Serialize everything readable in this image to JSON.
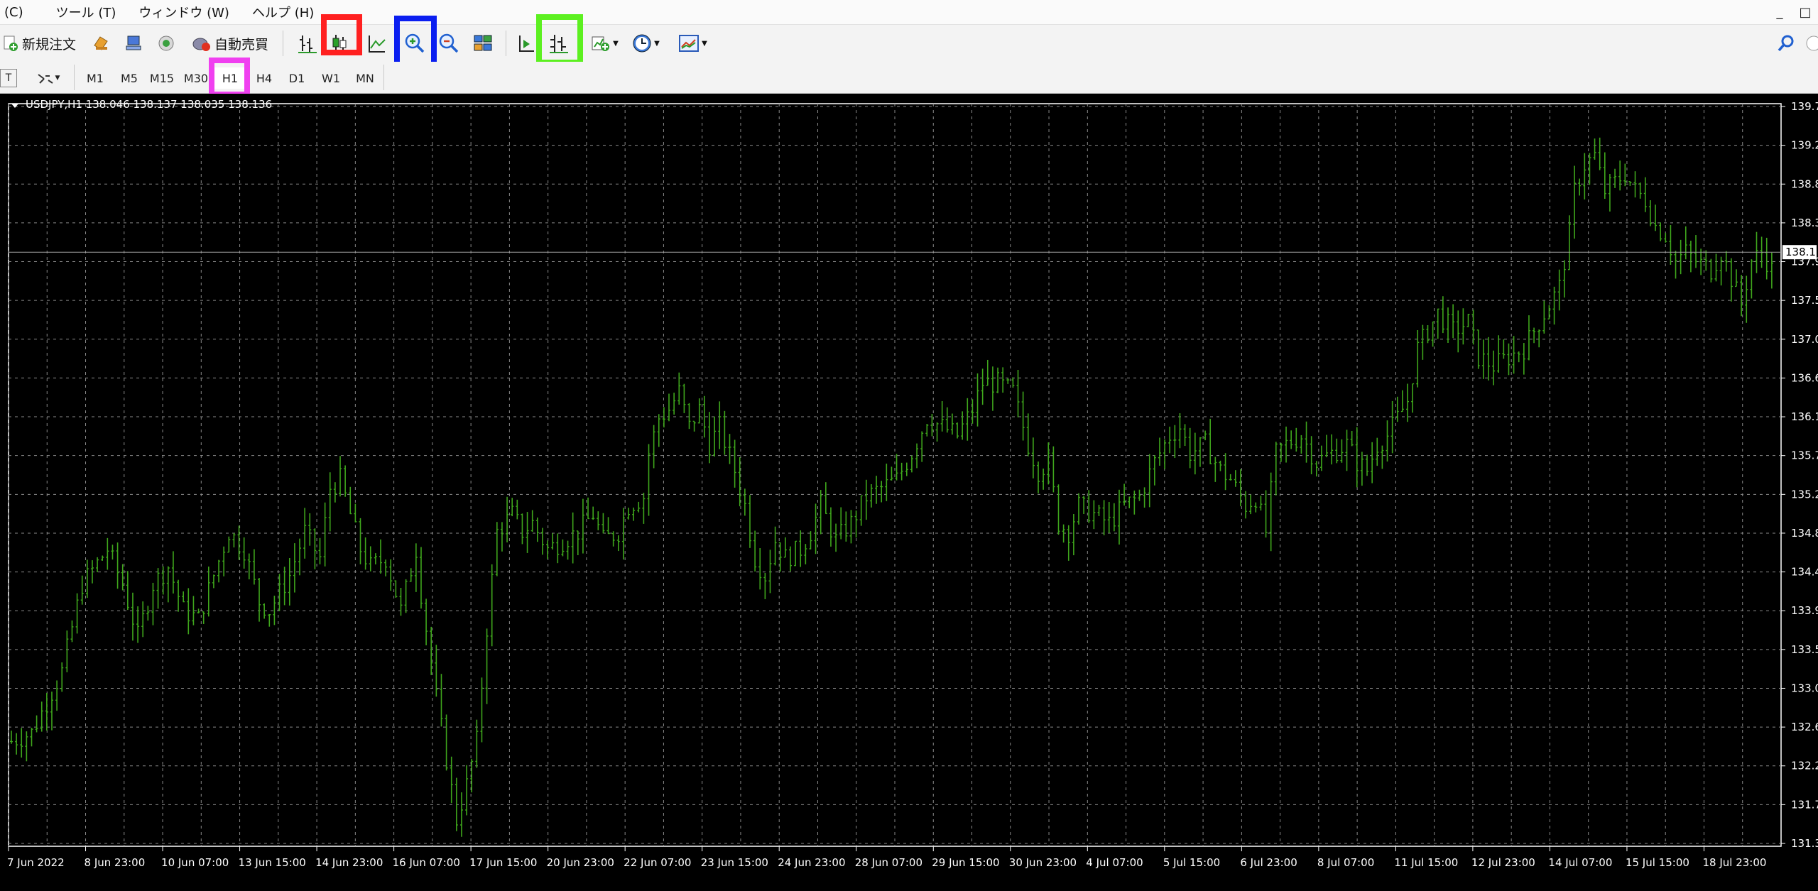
{
  "menu": {
    "items": [
      "(C)",
      "ツール (T)",
      "ウィンドウ (W)",
      "ヘルプ (H)"
    ],
    "window_minimize": "_",
    "window_restore": "□"
  },
  "toolbar": {
    "new_order_label": "新規注文",
    "auto_trade_label": "自動売買"
  },
  "timeframes": [
    "M1",
    "M5",
    "M15",
    "M30",
    "H1",
    "H4",
    "D1",
    "W1",
    "MN"
  ],
  "selected_timeframe": "H1",
  "highlight_colors": {
    "red": "#ff2020",
    "blue": "#0a1ef0",
    "green": "#5cf020",
    "magenta": "#f040f0"
  },
  "chart_data": {
    "type": "bar",
    "symbol_header": "USDJPY,H1  138.046 138.137 138.035 138.136",
    "current_price_label": "138.1",
    "current_price": 138.1,
    "ylim": [
      131.3,
      139.8
    ],
    "y_tick_labels": [
      "139.7",
      "139.2",
      "138.8",
      "138.3",
      "137.9",
      "137.5",
      "137.0",
      "136.6",
      "136.1",
      "135.7",
      "135.2",
      "134.8",
      "134.4",
      "133.9",
      "133.5",
      "133.0",
      "132.6",
      "132.2",
      "131.7",
      "131.3"
    ],
    "x_tick_labels": [
      "7 Jun 2022",
      "8 Jun 23:00",
      "10 Jun 07:00",
      "13 Jun 15:00",
      "14 Jun 23:00",
      "16 Jun 07:00",
      "17 Jun 15:00",
      "20 Jun 23:00",
      "22 Jun 07:00",
      "23 Jun 15:00",
      "24 Jun 23:00",
      "28 Jun 07:00",
      "29 Jun 15:00",
      "30 Jun 23:00",
      "4 Jul 07:00",
      "5 Jul 15:00",
      "6 Jul 23:00",
      "8 Jul 07:00",
      "11 Jul 15:00",
      "12 Jul 23:00",
      "14 Jul 07:00",
      "15 Jul 15:00",
      "18 Jul 23:00"
    ],
    "grid": true,
    "bar_color": "#3fa61c",
    "close_path_keypoints": [
      [
        0,
        132.5
      ],
      [
        4,
        132.6
      ],
      [
        10,
        133.3
      ],
      [
        14,
        134.3
      ],
      [
        19,
        134.7
      ],
      [
        22,
        134.3
      ],
      [
        25,
        133.7
      ],
      [
        28,
        134.3
      ],
      [
        31,
        134.5
      ],
      [
        34,
        134.0
      ],
      [
        37,
        133.9
      ],
      [
        40,
        134.4
      ],
      [
        43,
        134.9
      ],
      [
        46,
        134.7
      ],
      [
        49,
        134.1
      ],
      [
        51,
        134.0
      ],
      [
        55,
        134.4
      ],
      [
        58,
        134.9
      ],
      [
        61,
        134.6
      ],
      [
        63,
        135.4
      ],
      [
        65,
        135.5
      ],
      [
        69,
        134.7
      ],
      [
        71,
        134.5
      ],
      [
        74,
        134.6
      ],
      [
        77,
        134.0
      ],
      [
        80,
        134.7
      ],
      [
        81,
        134.2
      ],
      [
        84,
        133.0
      ],
      [
        86,
        132.3
      ],
      [
        88,
        131.6
      ],
      [
        90,
        132.0
      ],
      [
        92,
        132.5
      ],
      [
        94,
        133.8
      ],
      [
        96,
        134.9
      ],
      [
        99,
        135.1
      ],
      [
        101,
        134.9
      ],
      [
        103,
        135.0
      ],
      [
        106,
        134.7
      ],
      [
        109,
        134.8
      ],
      [
        112,
        134.9
      ],
      [
        115,
        135.1
      ],
      [
        117,
        134.8
      ],
      [
        120,
        134.9
      ],
      [
        122,
        135.2
      ],
      [
        125,
        135.3
      ],
      [
        126,
        135.8
      ],
      [
        128,
        136.2
      ],
      [
        130,
        136.3
      ],
      [
        132,
        136.5
      ],
      [
        134,
        136.1
      ],
      [
        136,
        136.3
      ],
      [
        138,
        135.9
      ],
      [
        140,
        136.1
      ],
      [
        143,
        135.6
      ],
      [
        145,
        135.2
      ],
      [
        147,
        134.6
      ],
      [
        149,
        134.4
      ],
      [
        151,
        134.8
      ],
      [
        153,
        134.6
      ],
      [
        156,
        134.7
      ],
      [
        158,
        134.9
      ],
      [
        160,
        135.2
      ],
      [
        163,
        134.8
      ],
      [
        166,
        135.0
      ],
      [
        169,
        135.3
      ],
      [
        172,
        135.4
      ],
      [
        175,
        135.5
      ],
      [
        178,
        135.8
      ],
      [
        181,
        136.2
      ],
      [
        184,
        136.1
      ],
      [
        187,
        136.0
      ],
      [
        190,
        136.3
      ],
      [
        192,
        136.6
      ],
      [
        195,
        136.6
      ],
      [
        198,
        136.5
      ],
      [
        201,
        135.9
      ],
      [
        203,
        135.6
      ],
      [
        205,
        135.7
      ],
      [
        207,
        135.0
      ],
      [
        209,
        134.9
      ],
      [
        211,
        135.2
      ],
      [
        214,
        135.1
      ],
      [
        217,
        135.0
      ],
      [
        220,
        135.2
      ],
      [
        223,
        135.3
      ],
      [
        226,
        135.7
      ],
      [
        229,
        136.0
      ],
      [
        231,
        136.1
      ],
      [
        233,
        135.8
      ],
      [
        236,
        135.9
      ],
      [
        239,
        135.6
      ],
      [
        241,
        135.5
      ],
      [
        244,
        135.2
      ],
      [
        246,
        135.3
      ],
      [
        248,
        134.9
      ],
      [
        250,
        135.8
      ],
      [
        252,
        135.9
      ],
      [
        255,
        136.0
      ],
      [
        258,
        135.7
      ],
      [
        261,
        135.8
      ],
      [
        264,
        135.9
      ],
      [
        266,
        135.7
      ],
      [
        268,
        135.6
      ],
      [
        270,
        135.9
      ],
      [
        272,
        136.0
      ],
      [
        274,
        136.2
      ],
      [
        276,
        136.4
      ],
      [
        278,
        137.0
      ],
      [
        280,
        137.2
      ],
      [
        282,
        137.4
      ],
      [
        285,
        137.2
      ],
      [
        288,
        137.3
      ],
      [
        290,
        136.9
      ],
      [
        293,
        136.8
      ],
      [
        296,
        136.9
      ],
      [
        299,
        137.0
      ],
      [
        302,
        137.3
      ],
      [
        304,
        137.5
      ],
      [
        306,
        137.7
      ],
      [
        308,
        138.3
      ],
      [
        309,
        138.8
      ],
      [
        311,
        139.1
      ],
      [
        313,
        139.2
      ],
      [
        315,
        138.8
      ],
      [
        317,
        138.9
      ],
      [
        319,
        139.0
      ],
      [
        321,
        138.8
      ],
      [
        323,
        138.7
      ],
      [
        325,
        138.4
      ],
      [
        327,
        138.3
      ],
      [
        329,
        138.0
      ],
      [
        331,
        138.1
      ],
      [
        333,
        138.0
      ],
      [
        336,
        137.9
      ],
      [
        338,
        138.1
      ],
      [
        340,
        137.8
      ],
      [
        342,
        137.5
      ],
      [
        344,
        138.0
      ],
      [
        346,
        138.1
      ],
      [
        348,
        137.9
      ]
    ]
  }
}
